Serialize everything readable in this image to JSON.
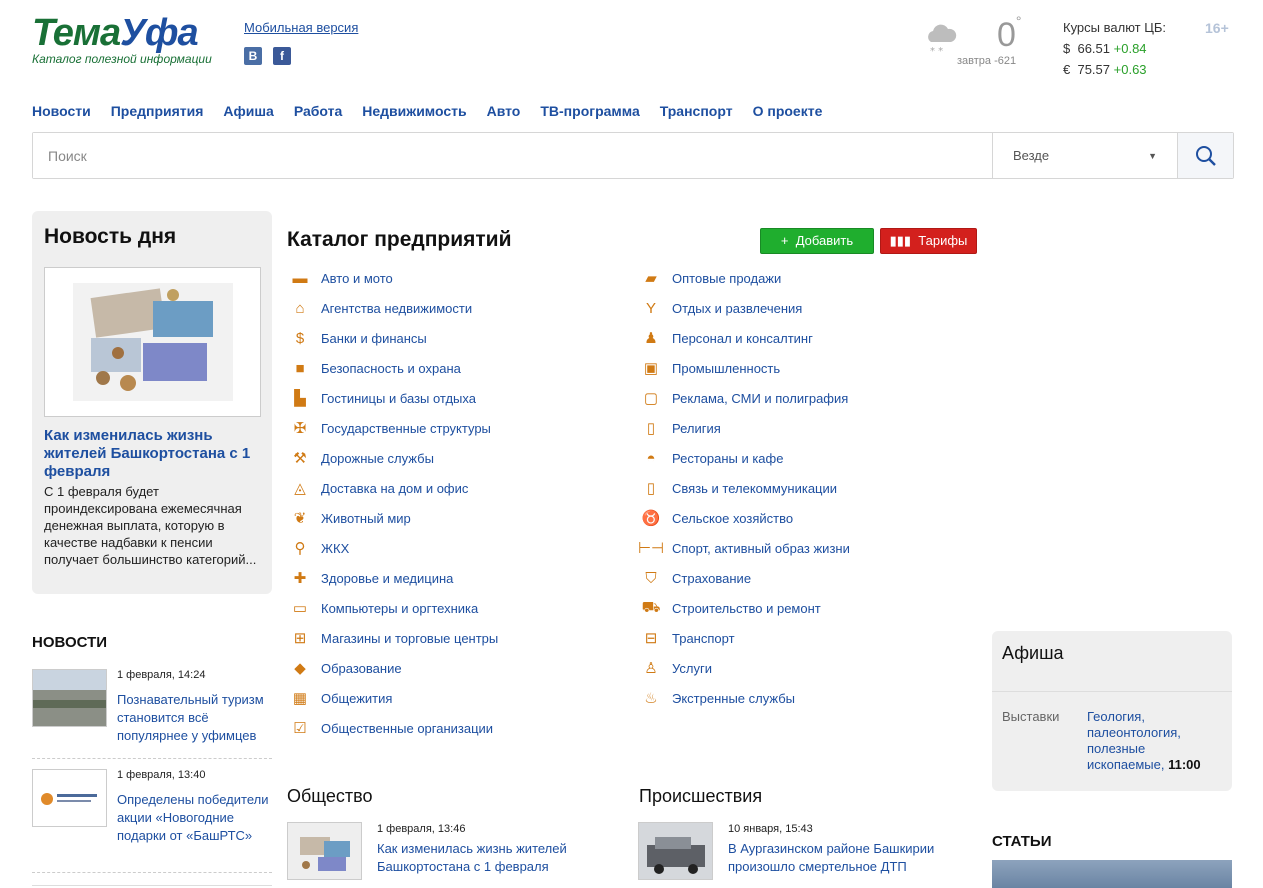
{
  "header": {
    "logo_a": "Тема",
    "logo_b": "Уфа",
    "logo_sub": "Каталог полезной информации",
    "mobile": "Мобильная версия",
    "vk": "В",
    "fb": "f",
    "temp": "0",
    "temp_unit": "°",
    "tomorrow": "завтра -621",
    "rates_title": "Курсы валют ЦБ:",
    "usd_sym": "$",
    "usd": "66.51",
    "usd_ch": "+0.84",
    "eur_sym": "€",
    "eur": "75.57",
    "eur_ch": "+0.63",
    "age": "16+"
  },
  "nav": [
    "Новости",
    "Предприятия",
    "Афиша",
    "Работа",
    "Недвижимость",
    "Авто",
    "ТВ-программа",
    "Транспорт",
    "О проекте"
  ],
  "search": {
    "placeholder": "Поиск",
    "scope": "Везде"
  },
  "news_day": {
    "heading": "Новость дня",
    "title": "Как изменилась жизнь жителей Башкортостана с 1 февраля",
    "text": "С 1 февраля будет проиндексирована ежемесячная денежная выплата, которую в качестве надбавки к пенсии получает большинство категорий..."
  },
  "news": {
    "heading": "НОВОСТИ",
    "items": [
      {
        "date": "1 февраля, 14:24",
        "title": "Познавательный туризм становится всё популярнее у уфимцев"
      },
      {
        "date": "1 февраля, 13:40",
        "title": "Определены победители акции «Новогодние подарки от «БашРТС»"
      }
    ]
  },
  "catalog": {
    "heading": "Каталог предприятий",
    "add": "Добавить",
    "tariffs": "Тарифы",
    "left": [
      "Авто и мото",
      "Агентства недвижимости",
      "Банки и финансы",
      "Безопасность и охрана",
      "Гостиницы и базы отдыха",
      "Государственные структуры",
      "Дорожные службы",
      "Доставка на дом и офис",
      "Животный мир",
      "ЖКХ",
      "Здоровье и медицина",
      "Компьютеры и оргтехника",
      "Магазины и торговые центры",
      "Образование",
      "Общежития",
      "Общественные организации"
    ],
    "right": [
      "Оптовые продажи",
      "Отдых и развлечения",
      "Персонал и консалтинг",
      "Промышленность",
      "Реклама, СМИ и полиграфия",
      "Религия",
      "Рестораны и кафе",
      "Связь и телекоммуникации",
      "Сельское хозяйство",
      "Спорт, активный образ жизни",
      "Страхование",
      "Строительство и ремонт",
      "Транспорт",
      "Услуги",
      "Экстренные службы"
    ]
  },
  "afisha": {
    "heading": "Афиша",
    "category": "Выставки",
    "event": "Геология, палеонтология, полезные ископаемые",
    "time": "11:00"
  },
  "articles": {
    "heading": "СТАТЬИ"
  },
  "society": {
    "heading": "Общество",
    "date": "1 февраля, 13:46",
    "title": "Как изменилась жизнь жителей Башкортостана с 1 февраля"
  },
  "incidents": {
    "heading": "Происшествия",
    "date": "10 января, 15:43",
    "title": "В Аургазинском районе Башкирии произошло смертельное ДТП"
  }
}
